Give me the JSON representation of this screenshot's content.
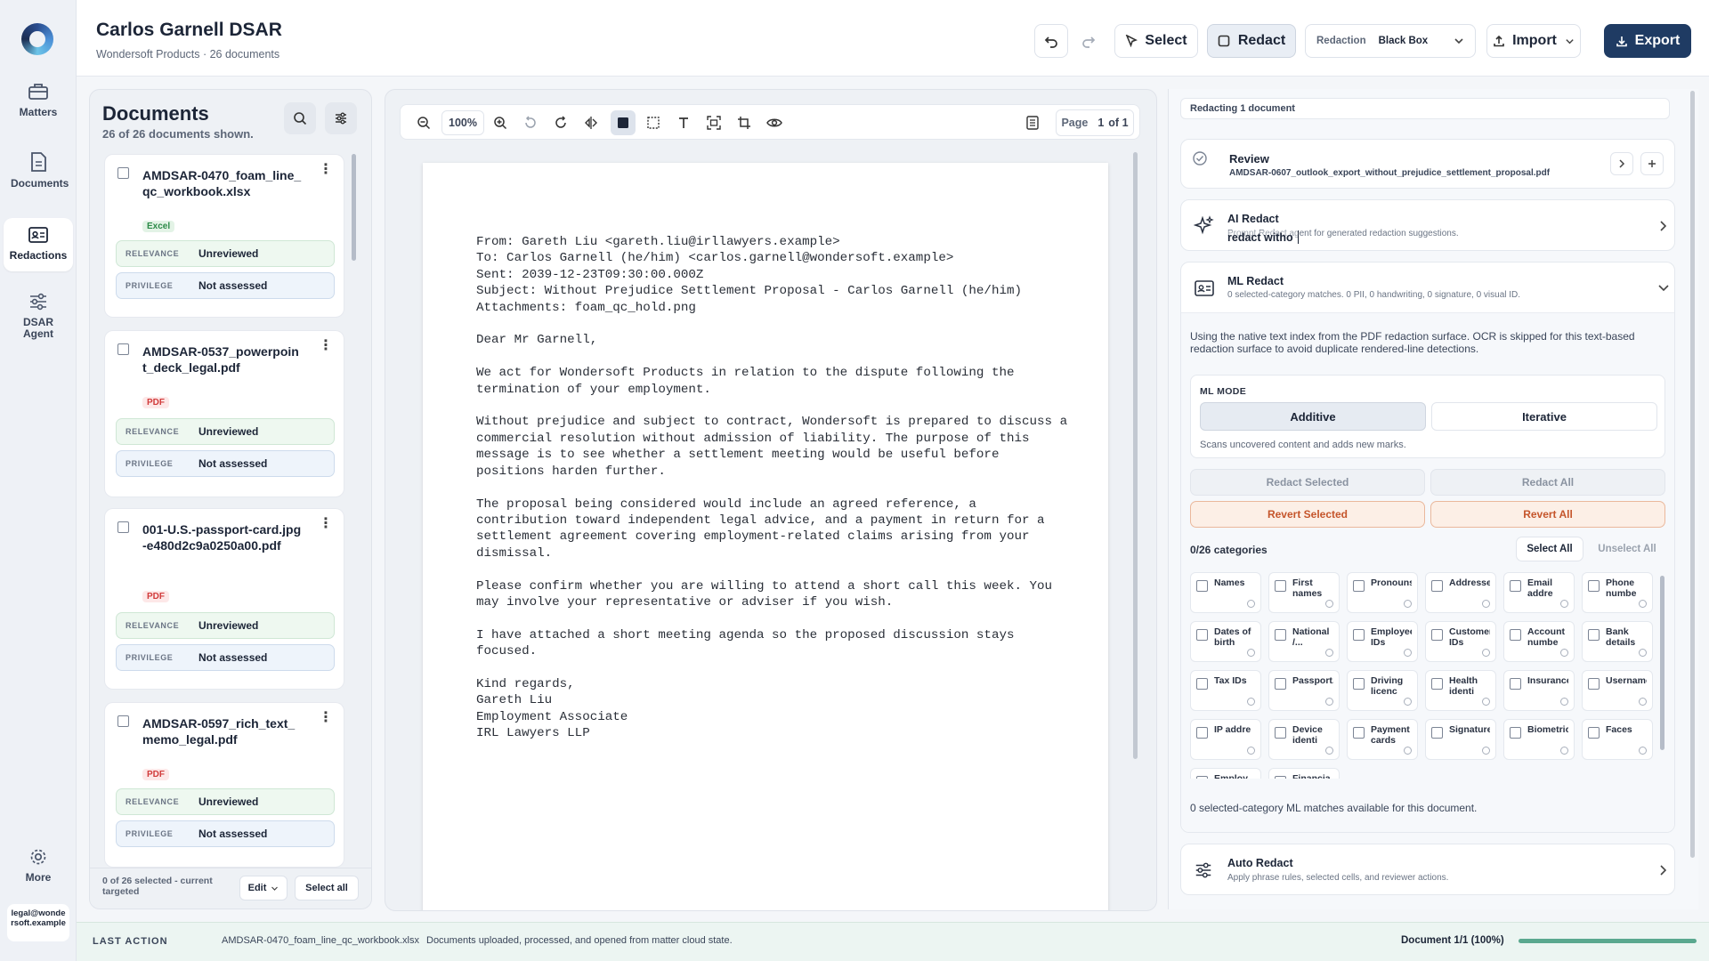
{
  "nav": {
    "items": [
      {
        "label": "Matters",
        "icon": "briefcase-icon"
      },
      {
        "label": "Documents",
        "icon": "document-icon"
      },
      {
        "label": "Redactions",
        "icon": "id-card-icon"
      },
      {
        "label": "DSAR Agent",
        "icon": "sliders-icon"
      }
    ],
    "more": "More",
    "user_email": "legal@wondersoft.example"
  },
  "header": {
    "title": "Carlos Garnell DSAR",
    "subtitle": "Wondersoft Products · 26 documents",
    "select_label": "Select",
    "redact_label": "Redact",
    "redaction_label": "Redaction",
    "redaction_value": "Black Box",
    "import_label": "Import",
    "export_label": "Export"
  },
  "documents": {
    "title": "Documents",
    "count_text": "26 of 26 documents shown.",
    "relevance_key": "RELEVANCE",
    "privilege_key": "PRIVILEGE",
    "items": [
      {
        "name": "AMDSAR-0470_foam_line_qc_workbook.xlsx",
        "type": "Excel",
        "relevance": "Unreviewed",
        "privilege": "Not assessed"
      },
      {
        "name": "AMDSAR-0537_powerpoint_deck_legal.pdf",
        "type": "PDF",
        "relevance": "Unreviewed",
        "privilege": "Not assessed"
      },
      {
        "name": "001-U.S.-passport-card.jpg-e480d2c9a0250a00.pdf",
        "type": "PDF",
        "relevance": "Unreviewed",
        "privilege": "Not assessed"
      },
      {
        "name": "AMDSAR-0597_rich_text_memo_legal.pdf",
        "type": "PDF",
        "relevance": "Unreviewed",
        "privilege": "Not assessed"
      }
    ],
    "footer_status": "0 of 26 selected - current targeted",
    "edit_label": "Edit",
    "select_all_label": "Select all"
  },
  "viewer": {
    "zoom": "100%",
    "page_label": "Page",
    "page_value": "1",
    "page_total": "of 1",
    "letter_lines": [
      "From: Gareth Liu <gareth.liu@irllawyers.example>",
      "To: Carlos Garnell (he/him) <carlos.garnell@wondersoft.example>",
      "Sent: 2039-12-23T09:30:00.000Z",
      "Subject: Without Prejudice Settlement Proposal - Carlos Garnell (he/him)",
      "Attachments: foam_qc_hold.png",
      "",
      "Dear Mr Garnell,",
      "",
      "We act for Wondersoft Products in relation to the dispute following the",
      "termination of your employment.",
      "",
      "Without prejudice and subject to contract, Wondersoft is prepared to discuss a",
      "commercial resolution without admission of liability. The purpose of this",
      "message is to see whether a settlement meeting would be useful before",
      "positions harden further.",
      "",
      "The proposal being considered would include an agreed reference, a",
      "contribution toward independent legal advice, and a payment in return for a",
      "settlement agreement covering employment-related claims arising from your",
      "dismissal.",
      "",
      "Please confirm whether you are willing to attend a short call this week. You",
      "may involve your representative or adviser if you wish.",
      "",
      "I have attached a short meeting agenda so the proposed discussion stays",
      "focused.",
      "",
      "Kind regards,",
      "Gareth Liu",
      "Employment Associate",
      "IRL Lawyers LLP"
    ]
  },
  "right": {
    "banner": "Redacting 1 document",
    "review_title": "Review",
    "review_file": "AMDSAR-0607_outlook_export_without_prejudice_settlement_proposal.pdf",
    "ai_title": "AI Redact",
    "ai_sub": "Prompt Redact agent for generated redaction suggestions.",
    "ai_typed": "redact witho",
    "ml_title": "ML Redact",
    "ml_sub": "0 selected-category matches. 0 PII, 0 handwriting, 0 signature, 0 visual ID.",
    "ml_desc": "Using the native text index from the PDF redaction surface. OCR is skipped for this text-based redaction surface to avoid duplicate rendered-line detections.",
    "ml_mode_label": "ML MODE",
    "mode_additive": "Additive",
    "mode_iterative": "Iterative",
    "mode_desc": "Scans uncovered content and adds new marks.",
    "redact_selected": "Redact Selected",
    "redact_all": "Redact All",
    "revert_selected": "Revert Selected",
    "revert_all": "Revert All",
    "categories_count": "0/26 categories",
    "select_all": "Select All",
    "unselect_all": "Unselect All",
    "categories": [
      "Names",
      "First names",
      "Pronouns",
      "Addresses",
      "Email addre",
      "Phone numbe",
      "Dates of birth",
      "National /...",
      "Employee IDs",
      "Customer IDs",
      "Account numbe",
      "Bank details",
      "Tax IDs",
      "Passport...",
      "Driving licenc",
      "Health identi",
      "Insurance...",
      "Usernames",
      "IP addre",
      "Device identi",
      "Payment cards",
      "Signatures",
      "Biometric...",
      "Faces",
      "Employ",
      "Financia"
    ],
    "ml_matches": "0 selected-category ML matches available for this document.",
    "auto_title": "Auto Redact",
    "auto_sub": "Apply phrase rules, selected cells, and reviewer actions."
  },
  "status": {
    "label": "LAST ACTION",
    "file": "AMDSAR-0470_foam_line_qc_workbook.xlsx",
    "message": "Documents uploaded, processed, and opened from matter cloud state.",
    "doc_progress": "Document 1/1 (100%)",
    "progress_fraction": 1.0
  },
  "colors": {
    "accent": "#1f3b63",
    "relevance_bg": "#eef8f0",
    "revert_bg": "#fcefe6",
    "revert_text": "#c5552b",
    "progress": "#5aa88f"
  }
}
